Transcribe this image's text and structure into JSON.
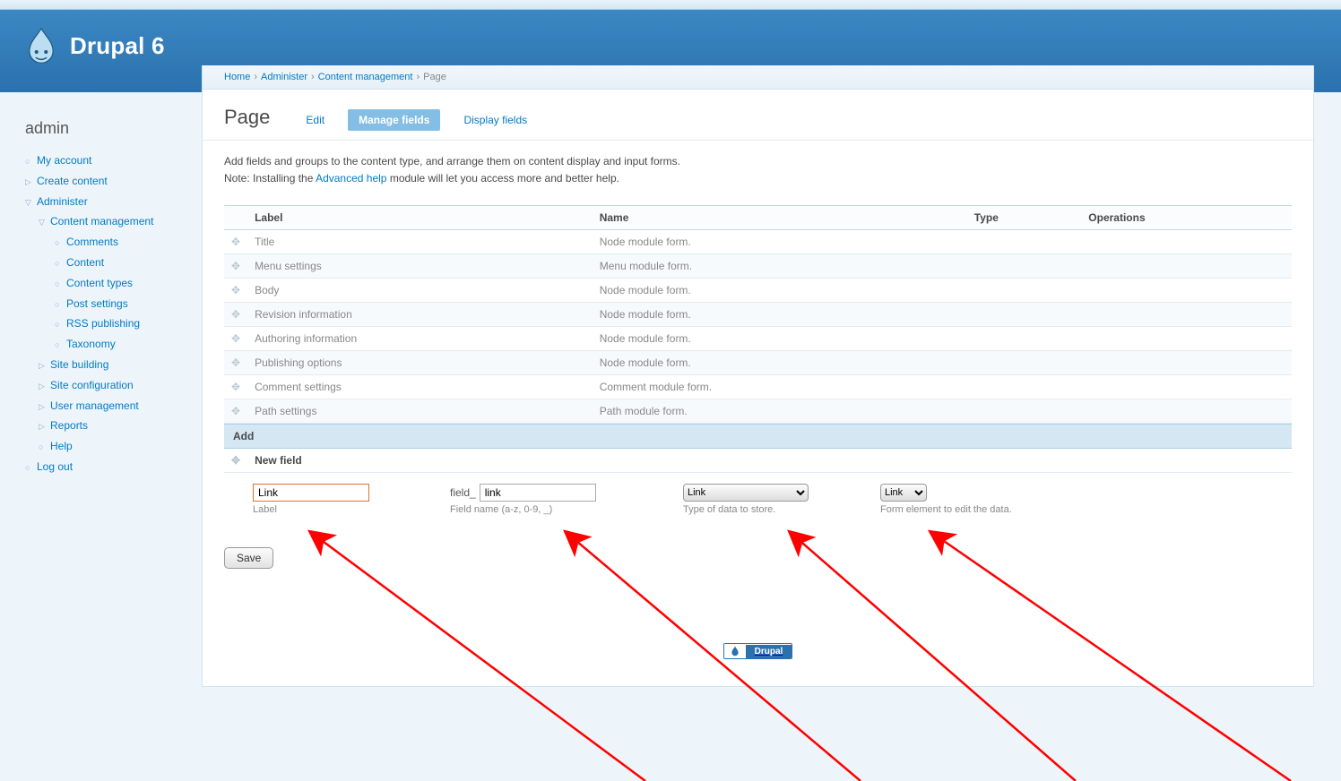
{
  "site_title": "Drupal 6",
  "sidebar": {
    "heading": "admin",
    "items": [
      {
        "label": "My account",
        "marker": "○"
      },
      {
        "label": "Create content",
        "marker": "▷"
      },
      {
        "label": "Administer",
        "marker": "▽",
        "children": [
          {
            "label": "Content management",
            "marker": "▽",
            "children": [
              {
                "label": "Comments",
                "marker": "○"
              },
              {
                "label": "Content",
                "marker": "○"
              },
              {
                "label": "Content types",
                "marker": "○"
              },
              {
                "label": "Post settings",
                "marker": "○"
              },
              {
                "label": "RSS publishing",
                "marker": "○"
              },
              {
                "label": "Taxonomy",
                "marker": "○"
              }
            ]
          },
          {
            "label": "Site building",
            "marker": "▷"
          },
          {
            "label": "Site configuration",
            "marker": "▷"
          },
          {
            "label": "User management",
            "marker": "▷"
          },
          {
            "label": "Reports",
            "marker": "▷"
          },
          {
            "label": "Help",
            "marker": "○"
          }
        ]
      },
      {
        "label": "Log out",
        "marker": "○"
      }
    ]
  },
  "breadcrumb": [
    "Home",
    "Administer",
    "Content management",
    "Page"
  ],
  "page_title": "Page",
  "tabs": [
    {
      "label": "Edit",
      "active": false
    },
    {
      "label": "Manage fields",
      "active": true
    },
    {
      "label": "Display fields",
      "active": false
    }
  ],
  "description_line1": "Add fields and groups to the content type, and arrange them on content display and input forms.",
  "description_note_prefix": "Note: Installing the ",
  "description_link": "Advanced help",
  "description_note_suffix": " module will let you access more and better help.",
  "table": {
    "headers": [
      "Label",
      "Name",
      "Type",
      "Operations"
    ],
    "rows": [
      {
        "label": "Title",
        "name": "Node module form."
      },
      {
        "label": "Menu settings",
        "name": "Menu module form."
      },
      {
        "label": "Body",
        "name": "Node module form."
      },
      {
        "label": "Revision information",
        "name": "Node module form."
      },
      {
        "label": "Authoring information",
        "name": "Node module form."
      },
      {
        "label": "Publishing options",
        "name": "Node module form."
      },
      {
        "label": "Comment settings",
        "name": "Comment module form."
      },
      {
        "label": "Path settings",
        "name": "Path module form."
      }
    ]
  },
  "add_header": "Add",
  "new_field_label": "New field",
  "form": {
    "label_value": "Link",
    "label_hint": "Label",
    "fieldname_prefix": "field_",
    "fieldname_value": "link",
    "fieldname_hint": "Field name (a-z, 0-9, _)",
    "type_value": "Link",
    "type_hint": "Type of data to store.",
    "widget_value": "Link",
    "widget_hint": "Form element to edit the data."
  },
  "save_button": "Save",
  "footer_badge": "Drupal"
}
